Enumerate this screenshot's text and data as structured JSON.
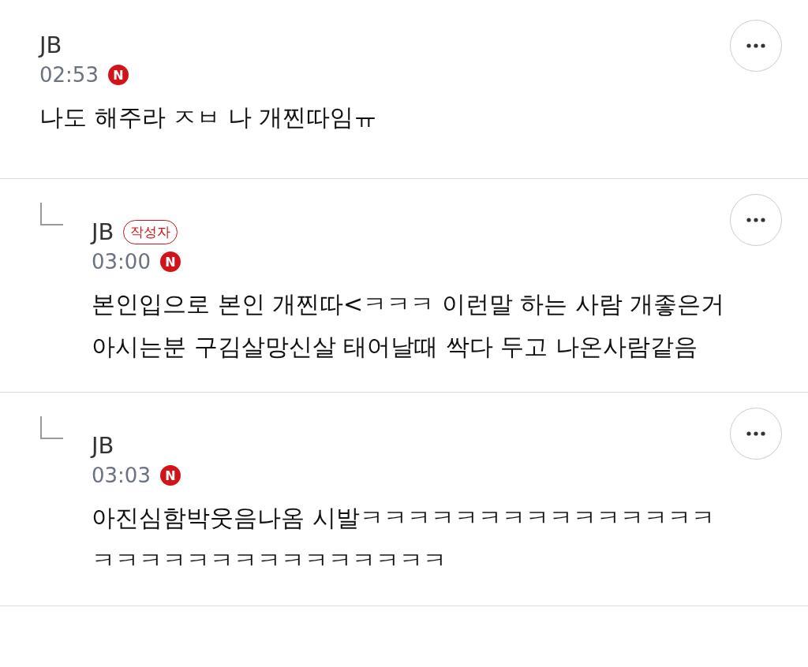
{
  "comments": [
    {
      "author": "JB",
      "time": "02:53",
      "mark": "N",
      "is_reply": false,
      "body": "나도 해주라 ㅈㅂ 나 개찐따임ㅠ"
    },
    {
      "author": "JB",
      "author_badge": "작성자",
      "time": "03:00",
      "mark": "N",
      "is_reply": true,
      "body": "본인입으로 본인 개찐따<ㅋㅋㅋ 이런말 하는 사람 개좋은거아시는분 구김살망신살 태어날때 싹다 두고 나온사람같음"
    },
    {
      "author": "JB",
      "time": "03:03",
      "mark": "N",
      "is_reply": true,
      "body": "아진심함박웃음나옴 시발ㅋㅋㅋㅋㅋㅋㅋㅋㅋㅋㅋㅋㅋㅋㅋㅋㅋㅋㅋㅋㅋㅋㅋㅋㅋㅋㅋㅋㅋㅋ"
    }
  ]
}
